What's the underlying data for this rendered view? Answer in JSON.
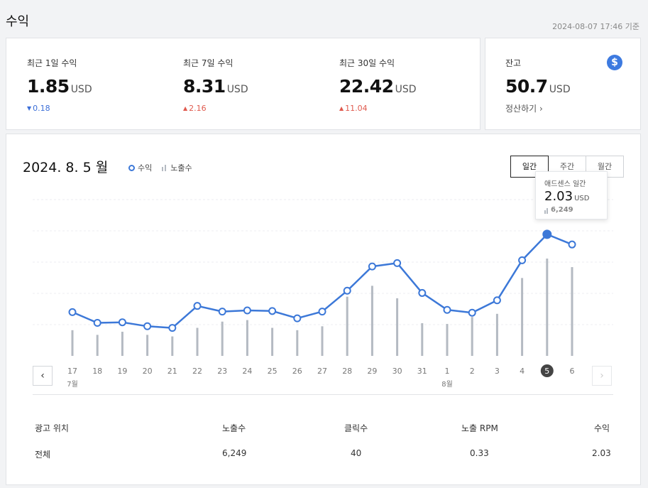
{
  "header": {
    "title": "수익",
    "timestamp": "2024-08-07 17:46 기준"
  },
  "stats": [
    {
      "label": "최근 1일 수익",
      "value": "1.85",
      "unit": "USD",
      "change": "0.18",
      "direction": "down"
    },
    {
      "label": "최근 7일 수익",
      "value": "8.31",
      "unit": "USD",
      "change": "2.16",
      "direction": "up"
    },
    {
      "label": "최근 30일 수익",
      "value": "22.42",
      "unit": "USD",
      "change": "11.04",
      "direction": "up"
    }
  ],
  "balance": {
    "label": "잔고",
    "value": "50.7",
    "unit": "USD",
    "action": "정산하기",
    "icon": "dollar-icon"
  },
  "chart_section": {
    "date_title": "2024. 8. 5 월",
    "legend": {
      "revenue": "수익",
      "impressions": "노출수"
    },
    "periods": [
      "일간",
      "주간",
      "월간"
    ],
    "active_period": "일간",
    "tooltip": {
      "label": "애드센스 일간",
      "value": "2.03",
      "unit": "USD",
      "impressions": "6,249"
    }
  },
  "chart_data": {
    "type": "line",
    "categories": [
      "17",
      "18",
      "19",
      "20",
      "21",
      "22",
      "23",
      "24",
      "25",
      "26",
      "27",
      "28",
      "29",
      "30",
      "31",
      "1",
      "2",
      "3",
      "4",
      "5",
      "6"
    ],
    "month_labels": [
      {
        "at": "17",
        "label": "7월"
      },
      {
        "at": "1",
        "label": "8월"
      }
    ],
    "selected": "5",
    "series": [
      {
        "name": "수익",
        "type": "line",
        "values": [
          0.65,
          0.46,
          0.47,
          0.4,
          0.37,
          0.76,
          0.66,
          0.68,
          0.67,
          0.54,
          0.66,
          1.03,
          1.46,
          1.52,
          0.99,
          0.69,
          0.64,
          0.86,
          1.57,
          2.03,
          1.85
        ]
      },
      {
        "name": "노출수",
        "type": "bar",
        "values": [
          1650,
          1350,
          1550,
          1350,
          1250,
          1800,
          2200,
          2300,
          1800,
          1650,
          1900,
          3800,
          4500,
          3700,
          2100,
          2050,
          2500,
          2700,
          5000,
          6249,
          5700
        ]
      }
    ]
  },
  "table": {
    "headers": [
      "광고 위치",
      "노출수",
      "클릭수",
      "노출 RPM",
      "수익"
    ],
    "rows": [
      [
        "전체",
        "6,249",
        "40",
        "0.33",
        "2.03"
      ]
    ]
  },
  "colors": {
    "line": "#3c78d8",
    "bar": "#b4bac2",
    "up": "#e05a4e",
    "down": "#3c6fd8"
  }
}
